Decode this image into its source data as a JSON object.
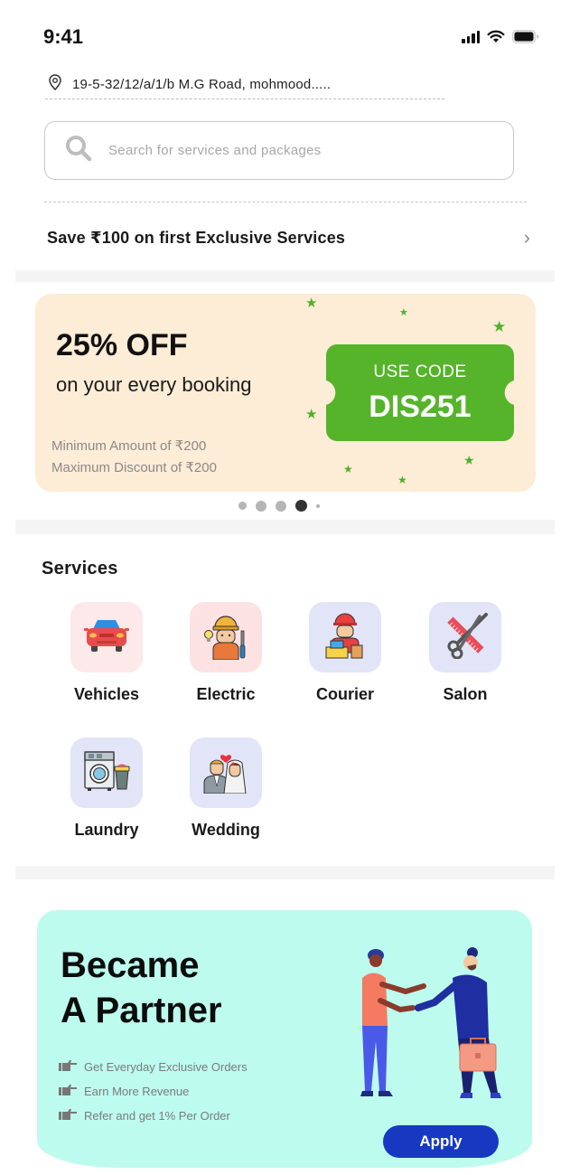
{
  "status_bar": {
    "time": "9:41",
    "icons": [
      "signal-icon",
      "wifi-icon",
      "battery-icon"
    ]
  },
  "location": {
    "icon": "map-pin-icon",
    "address": "19-5-32/12/a/1/b M.G Road, mohmood....."
  },
  "search": {
    "icon": "search-icon",
    "placeholder": "Search for services and packages"
  },
  "promo_link": {
    "text": "Save ₹100 on first Exclusive Services",
    "icon": "chevron-right-icon",
    "chevron": "›"
  },
  "offer_banner": {
    "title": "25% OFF",
    "subtitle": "on your every booking",
    "min_amount": "Minimum Amount of ₹200",
    "max_discount": "Maximum Discount of ₹200",
    "coupon_label": "USE CODE",
    "coupon_code": "DIS251",
    "colors": {
      "background": "#fdecd6",
      "coupon": "#55b42a",
      "stars": "#4fb02a"
    }
  },
  "carousel": {
    "total_dots": 5,
    "active_index": 3
  },
  "services": {
    "title": "Services",
    "items": [
      {
        "label": "Vehicles",
        "icon": "car-icon",
        "tile_color": "#fde8ea"
      },
      {
        "label": "Electric",
        "icon": "electrician-icon",
        "tile_color": "#fde2e4"
      },
      {
        "label": "Courier",
        "icon": "courier-icon",
        "tile_color": "#e1e5f7"
      },
      {
        "label": "Salon",
        "icon": "scissors-comb-icon",
        "tile_color": "#e1e5f7"
      },
      {
        "label": "Laundry",
        "icon": "washing-machine-icon",
        "tile_color": "#e1e5f7"
      },
      {
        "label": "Wedding",
        "icon": "wedding-couple-icon",
        "tile_color": "#e1e5f7"
      }
    ]
  },
  "partner_card": {
    "title_line1": "Became",
    "title_line2": "A Partner",
    "perks": [
      {
        "icon": "pointing-hand-icon",
        "text": "Get Everyday Exclusive Orders"
      },
      {
        "icon": "pointing-hand-icon",
        "text": "Earn More Revenue"
      },
      {
        "icon": "pointing-hand-icon",
        "text": "Refer and get 1% Per Order"
      }
    ],
    "apply_label": "Apply",
    "illustration": "handshake-illustration",
    "colors": {
      "background": "#bdfbee",
      "button": "#1739c1"
    }
  }
}
